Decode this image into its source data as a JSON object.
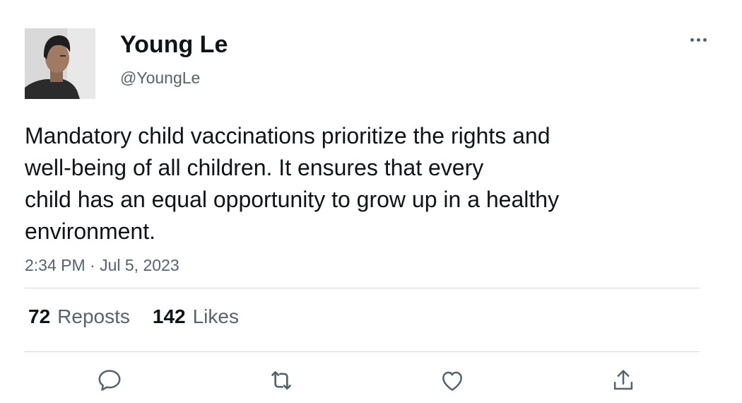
{
  "tweet": {
    "author": {
      "display_name": "Young Le",
      "handle": "@YoungLe"
    },
    "text_lines": [
      "Mandatory child vaccinations prioritize the rights and",
      "well-being of all children. It ensures that every",
      "child has an equal opportunity to grow up in a healthy",
      "environment."
    ],
    "timestamp": "2:34 PM · Jul 5, 2023",
    "stats": {
      "reposts_count": "72",
      "reposts_label": "Reposts",
      "likes_count": "142",
      "likes_label": "Likes"
    }
  },
  "icons": {
    "more": "more-horizontal-icon",
    "reply": "reply-icon",
    "repost": "repost-icon",
    "like": "heart-icon",
    "share": "share-icon"
  },
  "colors": {
    "text_primary": "#0f1419",
    "text_secondary": "#536471",
    "divider": "#cfd9de"
  }
}
